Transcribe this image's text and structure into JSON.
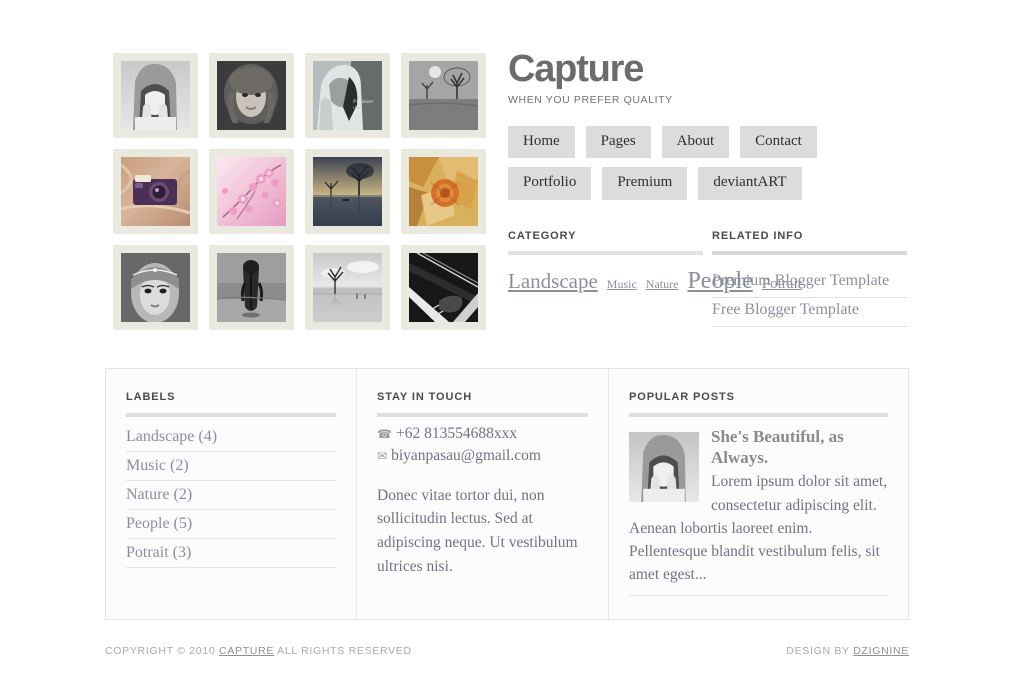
{
  "header": {
    "logo": "Capture",
    "tagline": "WHEN YOU PREFER QUALITY",
    "nav": [
      {
        "label": "Home"
      },
      {
        "label": "Pages"
      },
      {
        "label": "About"
      },
      {
        "label": "Contact"
      },
      {
        "label": "Portfolio"
      },
      {
        "label": "Premium"
      },
      {
        "label": "deviantART"
      }
    ]
  },
  "gallery": {
    "items": [
      {
        "alt": "Woman covering face with hands, black and white"
      },
      {
        "alt": "Portrait of curly haired woman, black and white"
      },
      {
        "alt": "Girl in hooded jacket with text overlay"
      },
      {
        "alt": "Bare trees in field, black and white"
      },
      {
        "alt": "Vintage purple camera on patterned cloth"
      },
      {
        "alt": "Pink cherry blossom branches"
      },
      {
        "alt": "Lone tree by lake at dusk"
      },
      {
        "alt": "Orange autumn leaves close up"
      },
      {
        "alt": "Woman with headpiece, black and white portrait"
      },
      {
        "alt": "Person standing with umbrella, black and white"
      },
      {
        "alt": "Bare tree in flooded lake, black and white"
      },
      {
        "alt": "Hand playing cello strings, black and white"
      }
    ]
  },
  "category": {
    "heading": "CATEGORY",
    "tags": [
      {
        "label": "Landscape",
        "size": "tag-lg"
      },
      {
        "label": "Music",
        "size": "tag-sm"
      },
      {
        "label": "Nature",
        "size": "tag-sm"
      },
      {
        "label": "People",
        "size": "tag-xl"
      },
      {
        "label": "Potrait",
        "size": "tag-md"
      }
    ]
  },
  "related_info": {
    "heading": "RELATED INFO",
    "items": [
      {
        "label": "Premium Blogger Template"
      },
      {
        "label": "Free Blogger Template"
      }
    ]
  },
  "labels": {
    "heading": "LABELS",
    "items": [
      {
        "label": "Landscape (4)"
      },
      {
        "label": "Music (2)"
      },
      {
        "label": "Nature (2)"
      },
      {
        "label": "People (5)"
      },
      {
        "label": "Potrait (3)"
      }
    ]
  },
  "stay_in_touch": {
    "heading": "STAY IN TOUCH",
    "phone_icon": "phone-icon",
    "phone": "+62 813554688xxx",
    "email_icon": "envelope-icon",
    "email": "biyanpasau@gmail.com",
    "description": "Donec vitae tortor dui, non sollicitudin lectus. Sed at adipiscing neque. Ut vestibulum ultrices nisi."
  },
  "popular_posts": {
    "heading": "POPULAR POSTS",
    "posts": [
      {
        "title": "She's Beautiful, as Always.",
        "excerpt": "Lorem ipsum dolor sit amet, consectetur adipiscing elit. Aenean lobortis laoreet enim. Pellentesque blandit vestibulum felis, sit amet egest...",
        "thumb_alt": "Woman covering face with hands, black and white"
      }
    ]
  },
  "footer": {
    "copyright_prefix": "COPYRIGHT © 2010",
    "copyright_link": "CAPTURE",
    "copyright_suffix": "ALL RIGHTS RESERVED",
    "design_prefix": "DESIGN BY",
    "design_link": "DZIGNINE"
  },
  "colors": {
    "logo": "#6c6c6c",
    "link": "#8a8f9c",
    "nav_bg": "#dcdcdc",
    "frame": "#e9e9e0",
    "panel_border": "#e3e3e3",
    "rule": "#e2e2e2"
  }
}
